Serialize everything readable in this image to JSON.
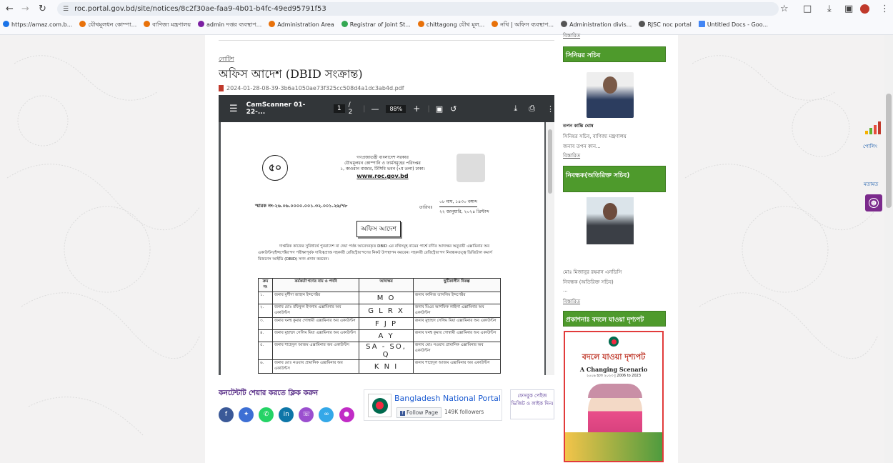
{
  "browser": {
    "url": "roc.portal.gov.bd/site/notices/8c2f30ae-faa9-4b01-b4fc-49ed95791f53",
    "bookmarks": [
      {
        "label": "https://amaz.com.b...",
        "color": "#1a73e8"
      },
      {
        "label": "যৌথমূলধন কোম্পা...",
        "color": "#e8710a"
      },
      {
        "label": "বাণিজ্য মন্ত্রণালয়",
        "color": "#e8710a"
      },
      {
        "label": "admin দপ্তর ব্যবস্থাপ...",
        "color": "#7b1fa2"
      },
      {
        "label": "Administration Area",
        "color": "#e8710a"
      },
      {
        "label": "Registrar of Joint St...",
        "color": "#34a853"
      },
      {
        "label": "chittagong যৌথ মূল...",
        "color": "#e8710a"
      },
      {
        "label": "নথি | অফিস ব্যবস্থাপ...",
        "color": "#e8710a"
      },
      {
        "label": "Administration divis...",
        "color": "#555555"
      },
      {
        "label": "RJSC noc portal",
        "color": "#555555"
      },
      {
        "label": "Untitled Docs - Goo...",
        "color": "#4285f4"
      }
    ]
  },
  "notice": {
    "category": "নোটিশ",
    "title": "অফিস আদেশ (DBID সংক্রান্ত)",
    "file_name": "2024-01-28-08-39-3b6a1050ae73f325cc508d4a1dc3ab4d.pdf"
  },
  "pdf_viewer": {
    "file_title": "CamScanner 01-22-...",
    "page_current": "1",
    "page_total": "/ 2",
    "zoom": "88%",
    "minus": "—",
    "plus": "+"
  },
  "doc": {
    "gov_line1": "গণপ্রজাতন্ত্রী বাংলাদেশ সরকার",
    "gov_line2": "যৌথমূলধন কোম্পানি ও ফার্মসমূহের পরিদপ্তর",
    "gov_line3": "১, কাওরান বাজার, টিসিবি ভবন (৭ম তলা) ঢাকা।",
    "website": "www.roc.gov.bd",
    "memo": "স্মারক নং-২৬.০৬.০০০০.০০১.৩২.০০১.২৬/৭৮",
    "date_label": "তারিখঃ",
    "date_bn": "০৮ মাঘ, ১৪৩০ বঙ্গাব্দ",
    "date_en": "২২ জানুয়ারি, ২০২৪ খ্রিস্টাব্দ",
    "heading": "অফিস আদেশ",
    "para": "দাপ্তরিক কাজের সুবিধার্থে পুনরাদেশ না দেয়া পর্যন্ত আবেদনকৃত DBID এর নথিসমূহ নামের পার্শ্বে বর্ণিত আদ্যক্ষর অনুযায়ী এক্সামিনার অব একাউন্টস/ইন্সপেক্টর'গণ পরীক্ষাপূর্বক দায়িত্বপ্রাপ্ত সহকারী রেজিস্ট্রার'গণের নিকট উপস্থাপন করবেন। সহকারী রেজিস্ট্রার'গণ নিবন্ধকতত্ত্ব ডিজিটাল কমার্স বিজনেস আইডি (DBID) সনদ প্রদান করবেন।",
    "table_headers": [
      "ক্রম নং",
      "কর্মকর্তা'গণের নাম ও পদবি",
      "আদ্যক্ষর",
      "ছুটিকালীন বিকল্প"
    ],
    "rows": [
      {
        "no": "১.",
        "name": "জনাব মুর্শীদা জাহান ইন্সপেক্টর",
        "code": "M O",
        "alt": "জনাব কানিজ তাসলিম ইন্সপেক্টর"
      },
      {
        "no": "২.",
        "name": "জনাব মোঃ রফিকুল ইসলাম এক্সামিনার অব একাউন্টস",
        "code": "G L R X",
        "alt": "জনাব মিএর আশফিক লাইলা এক্সামিনার অব একাউন্টস"
      },
      {
        "no": "৩.",
        "name": "জনাব ঘনশ্ব কুমার গোস্বামী এক্সামিনার অব একাউন্টস",
        "code": "F J P",
        "alt": "জনাব মুহাম্মদ সেলিম মিয়া এক্সামিনার অব একাউন্টস"
      },
      {
        "no": "৪.",
        "name": "জনাব মুহাম্মদ সেলিম মিয়া এক্সামিনার অব একাউন্টস",
        "code": "A Y",
        "alt": "জনাব ঘনশ্ব কুমার গোস্বামী এক্সামিনার অব একাউন্টস"
      },
      {
        "no": "৫.",
        "name": "জনাব শাহেদুল আজম এক্সামিনার অব একাউন্টস",
        "code": "SA - SO, Q",
        "alt": "জনাব মোঃ নওয়াব প্রামানিক এক্সামিনার অব একাউন্টস"
      },
      {
        "no": "৬.",
        "name": "জনাব মোঃ নওয়াব প্রামানিক এক্সামিনার অব একাউন্টস",
        "code": "K N I",
        "alt": "জনাব শাহেদুল আজম এক্সামিনার অব একাউন্টস"
      }
    ]
  },
  "share": {
    "label": "কনটেন্টটি শেয়ার করতে ক্লিক করুন"
  },
  "fb_widget": {
    "page_name": "Bangladesh National Portal",
    "follow": "Follow Page",
    "followers": "149K followers"
  },
  "fb_box2": "ফেসবুক পেইজ ভিজিট ও লাইক দিন।",
  "sidebar": {
    "top_link": "বিস্তারিত",
    "senior_secretary": {
      "heading": "সিনিয়র সচিব",
      "name": "তপন কান্তি ঘোষ",
      "desig": "সিনিয়র সচিব, বাণিজ্য মন্ত্রণালয়",
      "desc": "জনাব তপন কান...",
      "link": "বিস্তারিত"
    },
    "registrar": {
      "heading": "নিবন্ধক(অতিরিক্ত সচিব)",
      "name": "মোঃ মিজানুর রহমান এনডিসি",
      "desig": "নিবন্ধক (অতিরিক্ত সচিব)",
      "dots": "...",
      "link": "বিস্তারিত"
    },
    "publication": {
      "heading": "প্রকাশনাঃ বদলে যাওয়া দৃশ্যপট",
      "title_bn": "বদলে যাওয়া দৃশ্যপট",
      "title_en": "A Changing Scenario",
      "years": "২০০৯ হতে ২০২৩ | 2006 to 2023"
    }
  },
  "right_float": {
    "chart_label": "পোলিং",
    "opinion": "মতামত"
  }
}
